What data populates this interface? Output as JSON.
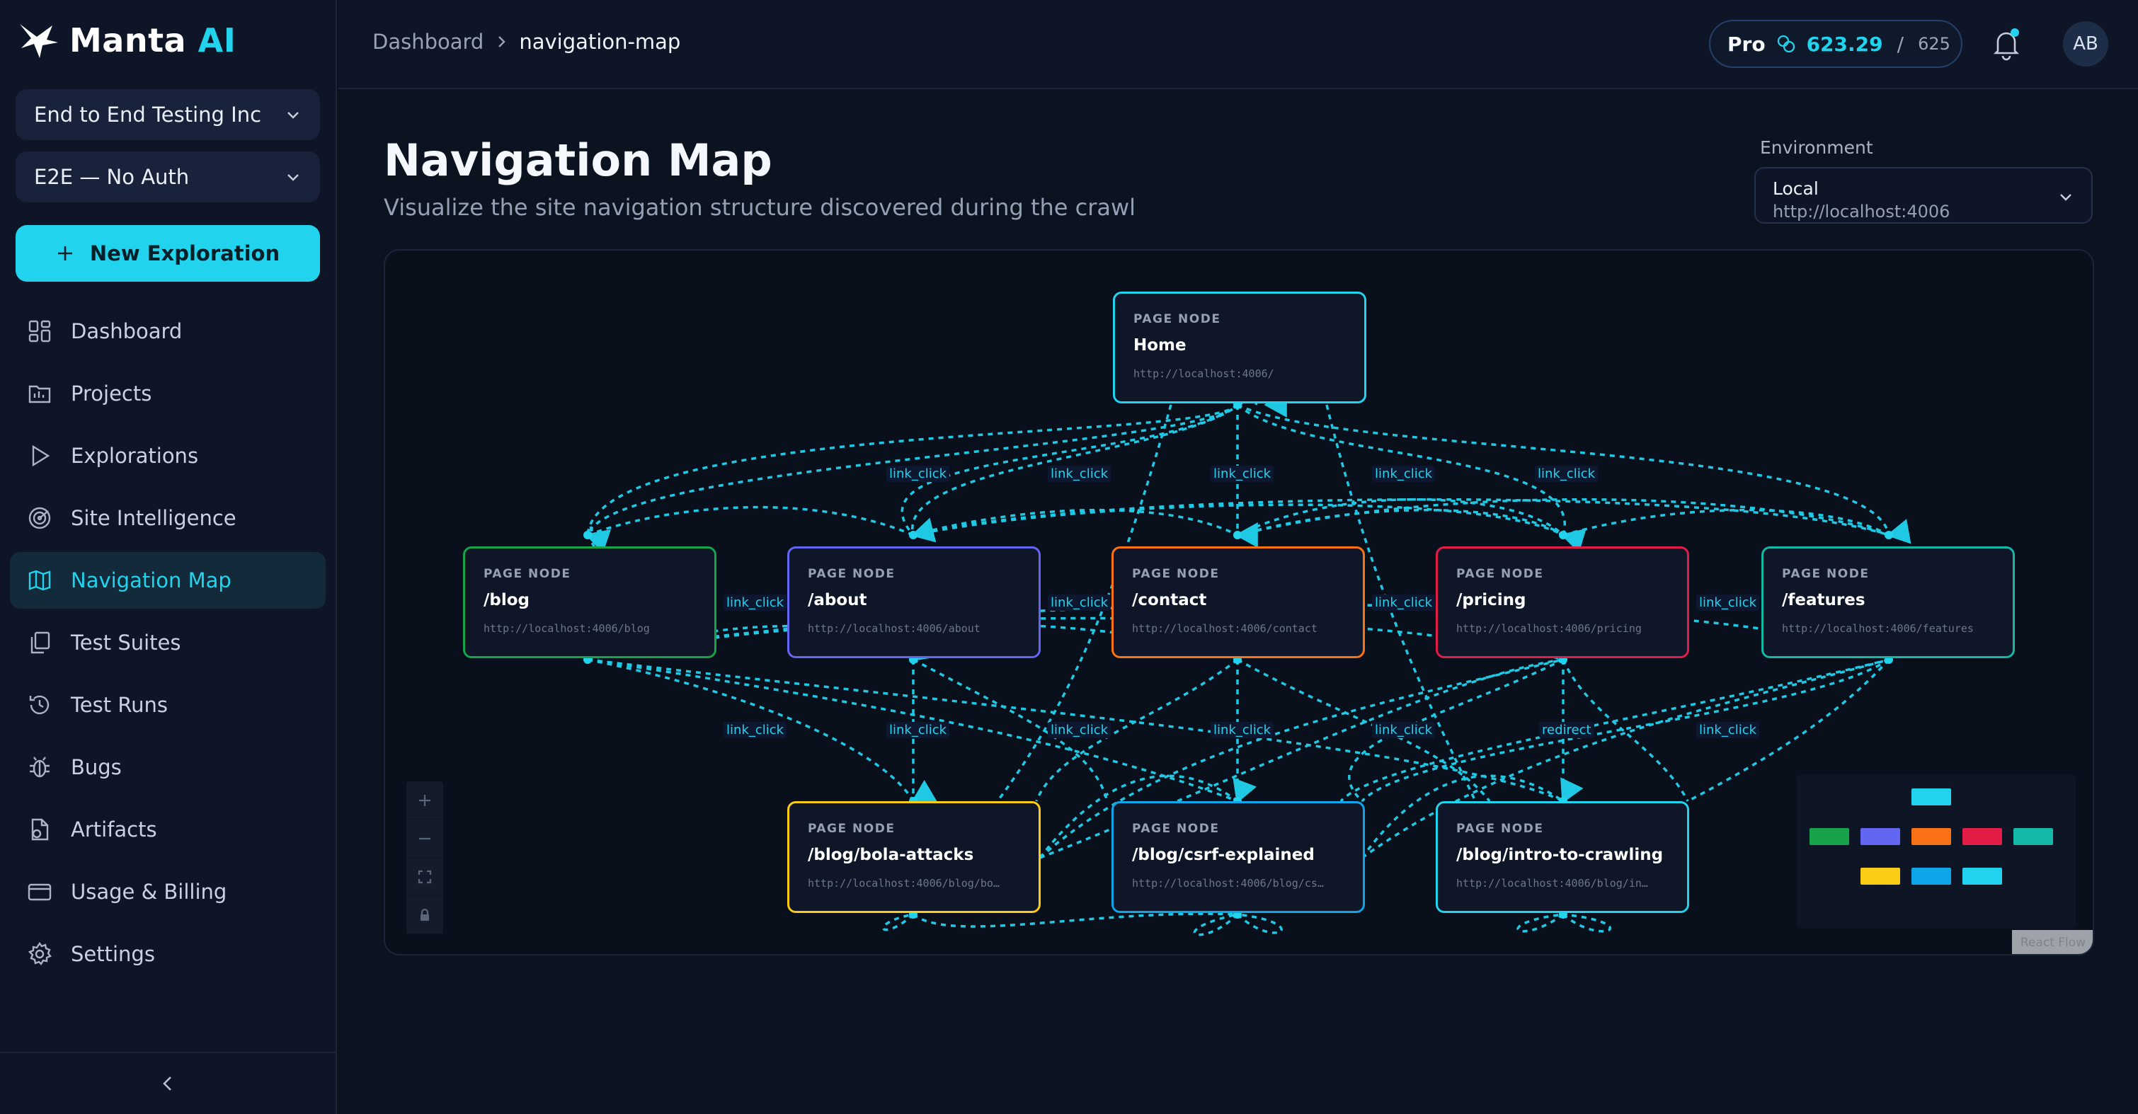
{
  "app": {
    "logo_word": "Manta",
    "logo_ai": "AI"
  },
  "sidebar": {
    "org_select": "End to End Testing Inc",
    "project_select": "E2E — No Auth",
    "new_button": "New Exploration",
    "items": [
      {
        "label": "Dashboard",
        "icon": "dashboard-icon"
      },
      {
        "label": "Projects",
        "icon": "folder-icon"
      },
      {
        "label": "Explorations",
        "icon": "play-icon"
      },
      {
        "label": "Site Intelligence",
        "icon": "radar-icon"
      },
      {
        "label": "Navigation Map",
        "icon": "map-icon",
        "active": true
      },
      {
        "label": "Test Suites",
        "icon": "copy-icon"
      },
      {
        "label": "Test Runs",
        "icon": "history-icon"
      },
      {
        "label": "Bugs",
        "icon": "bug-icon"
      },
      {
        "label": "Artifacts",
        "icon": "file-icon"
      },
      {
        "label": "Usage & Billing",
        "icon": "card-icon"
      },
      {
        "label": "Settings",
        "icon": "gear-icon"
      }
    ]
  },
  "header": {
    "breadcrumb_root": "Dashboard",
    "breadcrumb_current": "navigation-map",
    "plan": "Pro",
    "credits_used": "623.29",
    "credits_sep": "/",
    "credits_total": "625",
    "avatar_initials": "AB"
  },
  "page": {
    "title": "Navigation Map",
    "subtitle": "Visualize the site navigation structure discovered during the crawl",
    "env_label": "Environment",
    "env_name": "Local",
    "env_url": "http://localhost:4006"
  },
  "graph": {
    "node_kind": "PAGE NODE",
    "nodes": {
      "home": {
        "name": "Home",
        "url": "http://localhost:4006/"
      },
      "blog": {
        "name": "/blog",
        "url": "http://localhost:4006/blog"
      },
      "about": {
        "name": "/about",
        "url": "http://localhost:4006/about"
      },
      "contact": {
        "name": "/contact",
        "url": "http://localhost:4006/contact"
      },
      "pricing": {
        "name": "/pricing",
        "url": "http://localhost:4006/pricing"
      },
      "features": {
        "name": "/features",
        "url": "http://localhost:4006/features"
      },
      "bola": {
        "name": "/blog/bola-attacks",
        "url": "http://localhost:4006/blog/bo…"
      },
      "csrf": {
        "name": "/blog/csrf-explained",
        "url": "http://localhost:4006/blog/cs…"
      },
      "intro": {
        "name": "/blog/intro-to-crawling",
        "url": "http://localhost:4006/blog/in…"
      }
    },
    "edge_labels": {
      "link_click": "link_click",
      "redirect": "redirect"
    },
    "colors": {
      "edge": "#22d3ee",
      "home": "#22d3ee",
      "blog": "#16a34a",
      "about": "#6366f1",
      "contact": "#f97316",
      "pricing": "#e11d48",
      "features": "#14b8a6",
      "bola": "#facc15",
      "csrf": "#0ea5e9",
      "intro": "#22d3ee"
    },
    "attribution": "React Flow"
  }
}
